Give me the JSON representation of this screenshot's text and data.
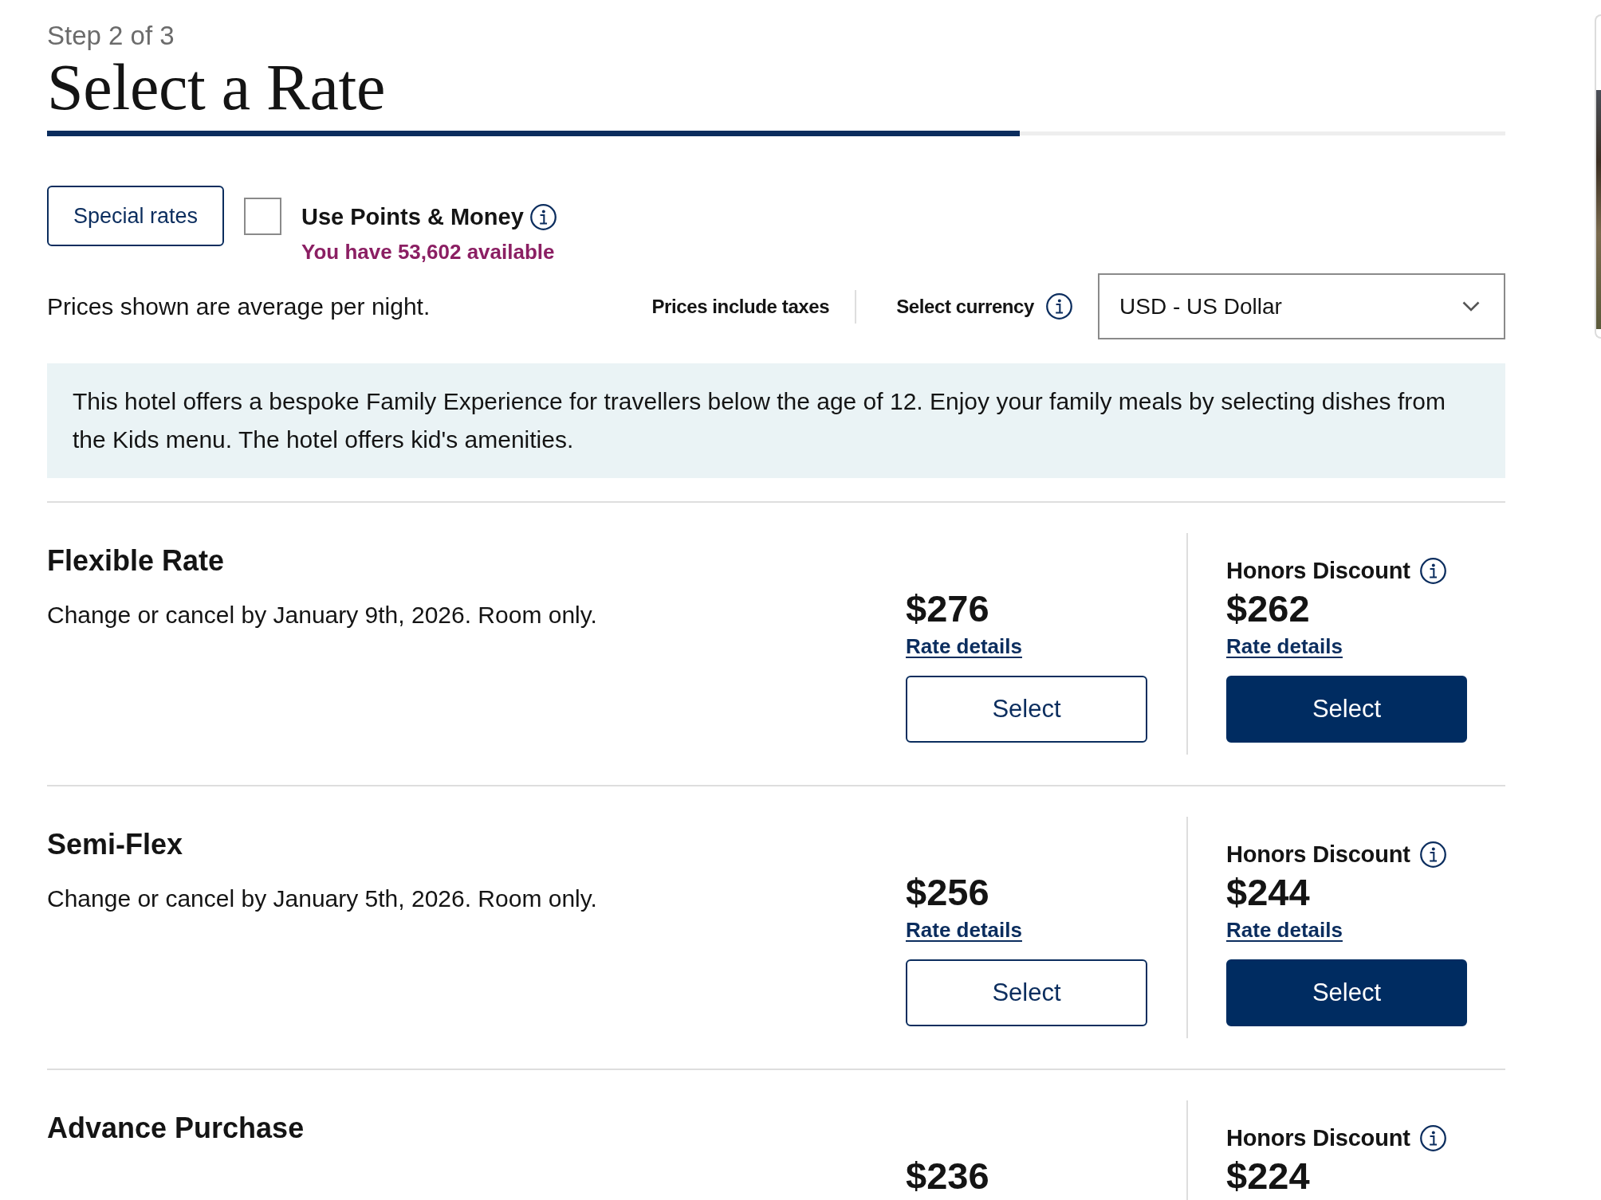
{
  "header": {
    "step": "Step 2 of 3",
    "title": "Select a Rate",
    "progress": {
      "level": 0.667
    }
  },
  "options": {
    "special_rates": {
      "label": "Special rates"
    },
    "points_toggle": {
      "label": "Use Points & Money",
      "checked": false,
      "balance": "You have 53,602 available"
    }
  },
  "pricing_bar": {
    "note": "Prices shown are average per night.",
    "taxes_note": "Prices include taxes",
    "currency_label": "Select currency",
    "currency_select": {
      "value": "USD - US Dollar"
    }
  },
  "banner": {
    "text": "This hotel offers a bespoke Family Experience for travellers below the age of 12. Enjoy your family meals by selecting dishes from the Kids menu. The hotel offers kid's amenities."
  },
  "rates": [
    {
      "name": "Flexible Rate",
      "description": "Change or cancel by January 9th, 2026. Room only.",
      "standard": {
        "price": "$276",
        "link": "Rate details",
        "button": "Select"
      },
      "discount": {
        "label": "Honors Discount",
        "price": "$262",
        "link": "Rate details",
        "button": "Select"
      }
    },
    {
      "name": "Semi-Flex",
      "description": "Change or cancel by January 5th, 2026. Room only.",
      "standard": {
        "price": "$256",
        "link": "Rate details",
        "button": "Select"
      },
      "discount": {
        "label": "Honors Discount",
        "price": "$244",
        "link": "Rate details",
        "button": "Select"
      }
    },
    {
      "name": "Advance Purchase",
      "standard": {
        "price": "$236"
      },
      "discount": {
        "label": "Honors Discount",
        "price": "$224"
      }
    }
  ]
}
